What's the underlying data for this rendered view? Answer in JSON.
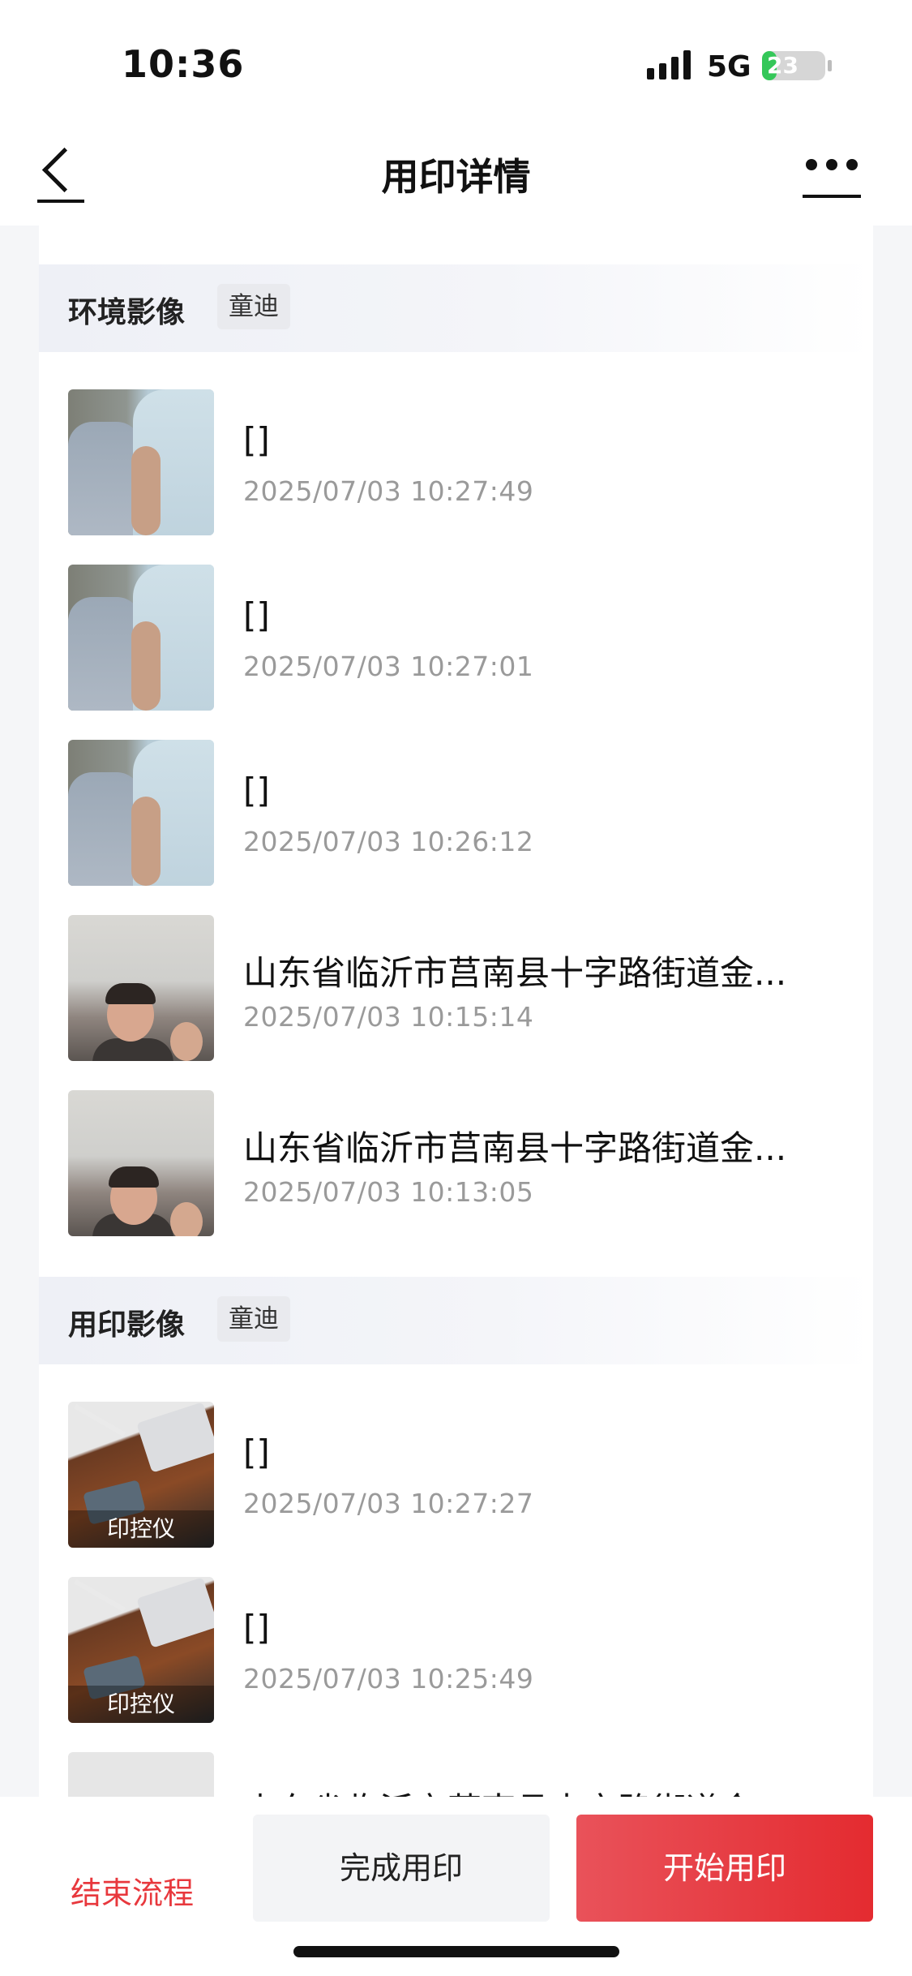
{
  "status_bar": {
    "time": "10:36",
    "network": "5G",
    "battery": "23",
    "battery_level": 0.23
  },
  "header": {
    "title": "用印详情",
    "back_icon": "back-arrow-icon",
    "more_icon": "more-icon"
  },
  "sections": [
    {
      "title": "环境影像",
      "tag": "童迪",
      "items": [
        {
          "title": "[]",
          "time": "2025/07/03 10:27:49"
        },
        {
          "title": "[]",
          "time": "2025/07/03 10:27:01"
        },
        {
          "title": "[]",
          "time": "2025/07/03 10:26:12"
        },
        {
          "title": "山东省临沂市莒南县十字路街道金...",
          "time": "2025/07/03 10:15:14"
        },
        {
          "title": "山东省临沂市莒南县十字路街道金...",
          "time": "2025/07/03 10:13:05"
        }
      ]
    },
    {
      "title": "用印影像",
      "tag": "童迪",
      "items": [
        {
          "title": "[]",
          "time": "2025/07/03 10:27:27",
          "thumb_label": "印控仪"
        },
        {
          "title": "[]",
          "time": "2025/07/03 10:25:49",
          "thumb_label": "印控仪"
        },
        {
          "title": "山东省临沂市莒南县十字路街道金"
        }
      ]
    }
  ],
  "actions": {
    "end_flow": "结束流程",
    "finish": "完成用印",
    "start": "开始用印"
  },
  "colors": {
    "accent": "#e42b30",
    "battery_green": "#34c759"
  }
}
